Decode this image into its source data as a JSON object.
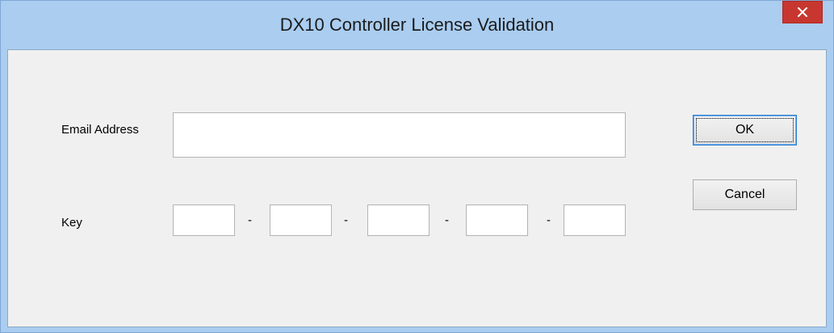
{
  "window": {
    "title": "DX10 Controller License Validation"
  },
  "titlebar": {
    "close_icon": "close-icon",
    "close_color": "#c7372f"
  },
  "form": {
    "email_label": "Email Address",
    "email_value": "",
    "key_label": "Key",
    "key_fields": [
      "",
      "",
      "",
      "",
      ""
    ],
    "separator": "-"
  },
  "buttons": {
    "ok_label": "OK",
    "cancel_label": "Cancel"
  }
}
